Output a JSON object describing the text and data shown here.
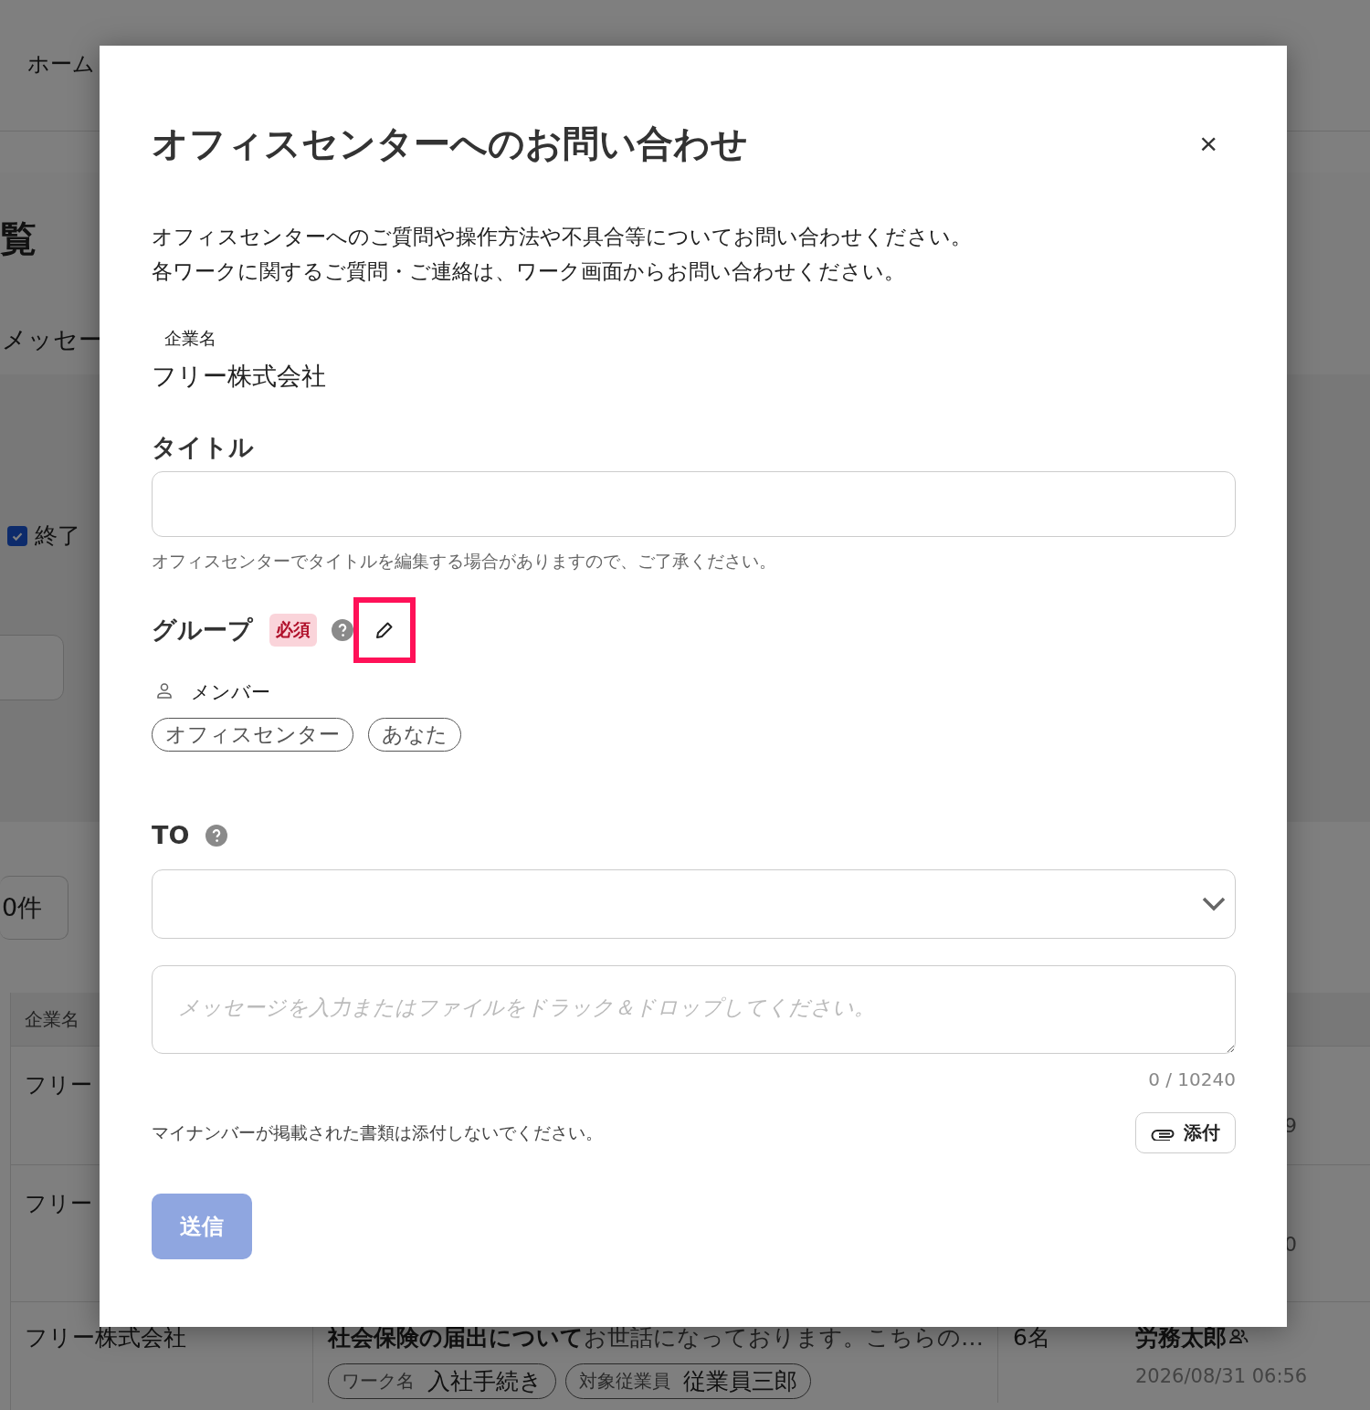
{
  "background": {
    "nav": {
      "home": "ホーム"
    },
    "page_title": "覧",
    "tab": "メッセー",
    "filter": {
      "checkbox": {
        "label": "終了",
        "checked": true
      }
    },
    "page_size": "0件",
    "table": {
      "columns": [
        "企業名"
      ],
      "rows": [
        {
          "company": "フリー",
          "column_5": "9"
        },
        {
          "company": "フリー",
          "column_5": "0"
        },
        {
          "company": "フリー株式会社",
          "message": "**社会保険の届出について**お世話になっております。こちらの…",
          "tags": [
            {
              "key": "ワーク名",
              "value": "入社手続き"
            },
            {
              "key": "対象従業員",
              "value": "従業員三郎"
            }
          ],
          "members": "6名",
          "assignee": "労務太郎",
          "time": "2026/08/31 06:56"
        }
      ]
    }
  },
  "dialog": {
    "title": "オフィスセンターへのお問い合わせ",
    "close": "×",
    "description": [
      "オフィスセンターへのご質問や操作方法や不具合等についてお問い合わせください。",
      "各ワークに関するご質問・ご連絡は、ワーク画面からお問い合わせください。"
    ],
    "company": {
      "label": "企業名",
      "value": "フリー株式会社"
    },
    "title_field": {
      "label": "タイトル",
      "hint": "オフィスセンターでタイトルを編集する場合がありますので、ご了承ください。"
    },
    "group": {
      "label": "グループ",
      "required": "必須",
      "edit_highlighted": true,
      "members_label": "メンバー",
      "members": [
        "オフィスセンター",
        "あなた"
      ]
    },
    "to": {
      "label": "TO"
    },
    "message": {
      "placeholder": "メッセージを入力またはファイルをドラック＆ドロップしてください。",
      "counter": "0 / 10240"
    },
    "note": "マイナンバーが掲載された書類は添付しないでください。",
    "attach": "添付",
    "send": {
      "label": "送信",
      "disabled": true
    }
  }
}
